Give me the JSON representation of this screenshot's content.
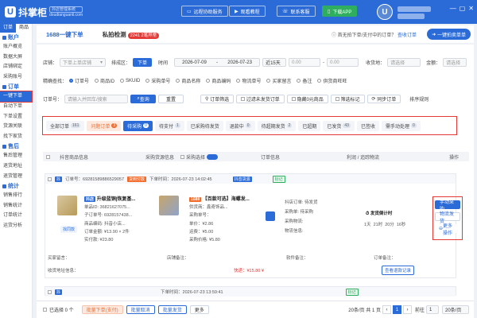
{
  "app": {
    "name": "抖掌柜",
    "subtitle_top": "抖店管理系统",
    "subtitle_bottom": "doudianguanli.com"
  },
  "topbar": {
    "buttons": [
      "远程协助服务",
      "观看教程",
      "联系客服",
      "下载APP"
    ]
  },
  "sidebar": {
    "tabs": [
      "订单",
      "商品"
    ],
    "sections": [
      {
        "title": "账户",
        "items": [
          "账户概览",
          "数据大屏",
          "店铺绑定",
          "采购账号"
        ]
      },
      {
        "title": "订单",
        "items": [
          "一键下单",
          "自动下单",
          "下单设置",
          "货源关联",
          "找下家货"
        ]
      },
      {
        "title": "售后",
        "items": [
          "售后管理",
          "退货地址",
          "退货管理"
        ]
      },
      {
        "title": "统计",
        "items": [
          "销售排行",
          "销售统计",
          "订单统计",
          "运货分析"
        ]
      }
    ]
  },
  "tabs": {
    "items": [
      "1688一键下单",
      "私拍检测"
    ],
    "badge": "2241 2笔异常",
    "note_prefix": "首无拍下单/支付中的订单？",
    "note_link": "查收订单",
    "old_button": "一键拍卖单单"
  },
  "filters": {
    "shop_label": "店铺：",
    "shop_value": "下单上单店铺",
    "time_label": "排成区：",
    "time_opt1": "下单",
    "time_opt2": "时间",
    "date_from": "2026-07-09",
    "date_to": "2026-07-23",
    "range": "近15天",
    "pay_label": "收货地：",
    "pay_value": "请选择",
    "amount_label": "金额：",
    "amount_value": "请选择",
    "precise_label": "精确查找：",
    "radios": [
      "订单号",
      "商品ID",
      "SKUID",
      "采购单号",
      "商品名称",
      "商品编码",
      "物流单号",
      "买家留言",
      "备注",
      "供货商旺旺"
    ],
    "search_label": "订单号：",
    "search_placeholder": "请输入并回车/搜索",
    "search_btn": "查询",
    "reset_btn": "重置",
    "extra_btns": [
      "订单筛选",
      "过滤未发货订单",
      "隐藏0元商品",
      "筛选标记",
      "同步订单"
    ],
    "sort": "排序规则"
  },
  "status_tabs": [
    {
      "label": "全部订单",
      "count": "161"
    },
    {
      "label": "问题订单",
      "count": "3"
    },
    {
      "label": "待采购",
      "count": "0"
    },
    {
      "label": "待支付",
      "count": "1"
    },
    {
      "label": "已采购待发货",
      "count": ""
    },
    {
      "label": "退款中",
      "count": "0"
    },
    {
      "label": "待超期发货",
      "count": "2"
    },
    {
      "label": "已超期",
      "count": ""
    },
    {
      "label": "已发货",
      "count": "43"
    },
    {
      "label": "已签收",
      "count": ""
    },
    {
      "label": "需手动处理",
      "count": "0"
    }
  ],
  "table": {
    "select_all": "全选",
    "headers": [
      "抖音商品信息",
      "采购货源信息",
      "采购选择",
      "订单信息",
      "利润 / 追踪物流",
      "操作"
    ],
    "recommend": "推荐"
  },
  "order1": {
    "order_no": "订单号：69281589886529057",
    "order_time": "下单时间：2026-07-23 14:02:45",
    "pay_tag": "货到付款",
    "source_tag": "抖音货源",
    "product_tag": "抖店",
    "product_name": "升级蓝铜|恢复基...",
    "sku_line": "单品ID: 36821627075...",
    "code_line": "子订单号: 6928157438...",
    "shop_line": "商品编码: 抖音小店...",
    "price_line": "订单金额: ¥13.90 × 2件",
    "pay_line": "实付款: ¥23.80",
    "similar_btn": "找同款",
    "src_tag": "1688",
    "src_name": "【百款可选】海螺发...",
    "src_shop": "供货商：鑫奇饰品...",
    "src_order": "采购单号：",
    "src_price": "单价：¥2.86",
    "src_freight": "运费：¥5.00",
    "src_total": "采购价格: ¥5.80",
    "mid_1": "抖店订单: 待发货",
    "mid_2": "采购单: 待采购",
    "mid_3": "采购物流:",
    "mid_4": "物流信息:",
    "deadline_label": "发货倒计时",
    "deadline": [
      "1天",
      "21时",
      "20分",
      "16秒"
    ],
    "buyer_label": "买家留言：",
    "remark_label": "店铺备注：",
    "assistant_label": "软件备注：",
    "order_label": "订单备注：",
    "addr_label": "收货地址信息：",
    "phone": "快递：¥15.80 ¥",
    "refund_btn": "查看退款记录"
  },
  "actions": [
    "手动采购",
    "物流发货",
    "更多操作"
  ],
  "order2": {
    "time": "下单时间：2026-07-23 13:59:41",
    "tag": "标记"
  },
  "footer": {
    "selected": "已选择 0 个",
    "btns": [
      "批量下单(支付)",
      "批量取消",
      "批量发货",
      "更多"
    ],
    "total": "20条/页 共 1 页",
    "page": "1",
    "goto": "前往",
    "per": "20条/页"
  }
}
